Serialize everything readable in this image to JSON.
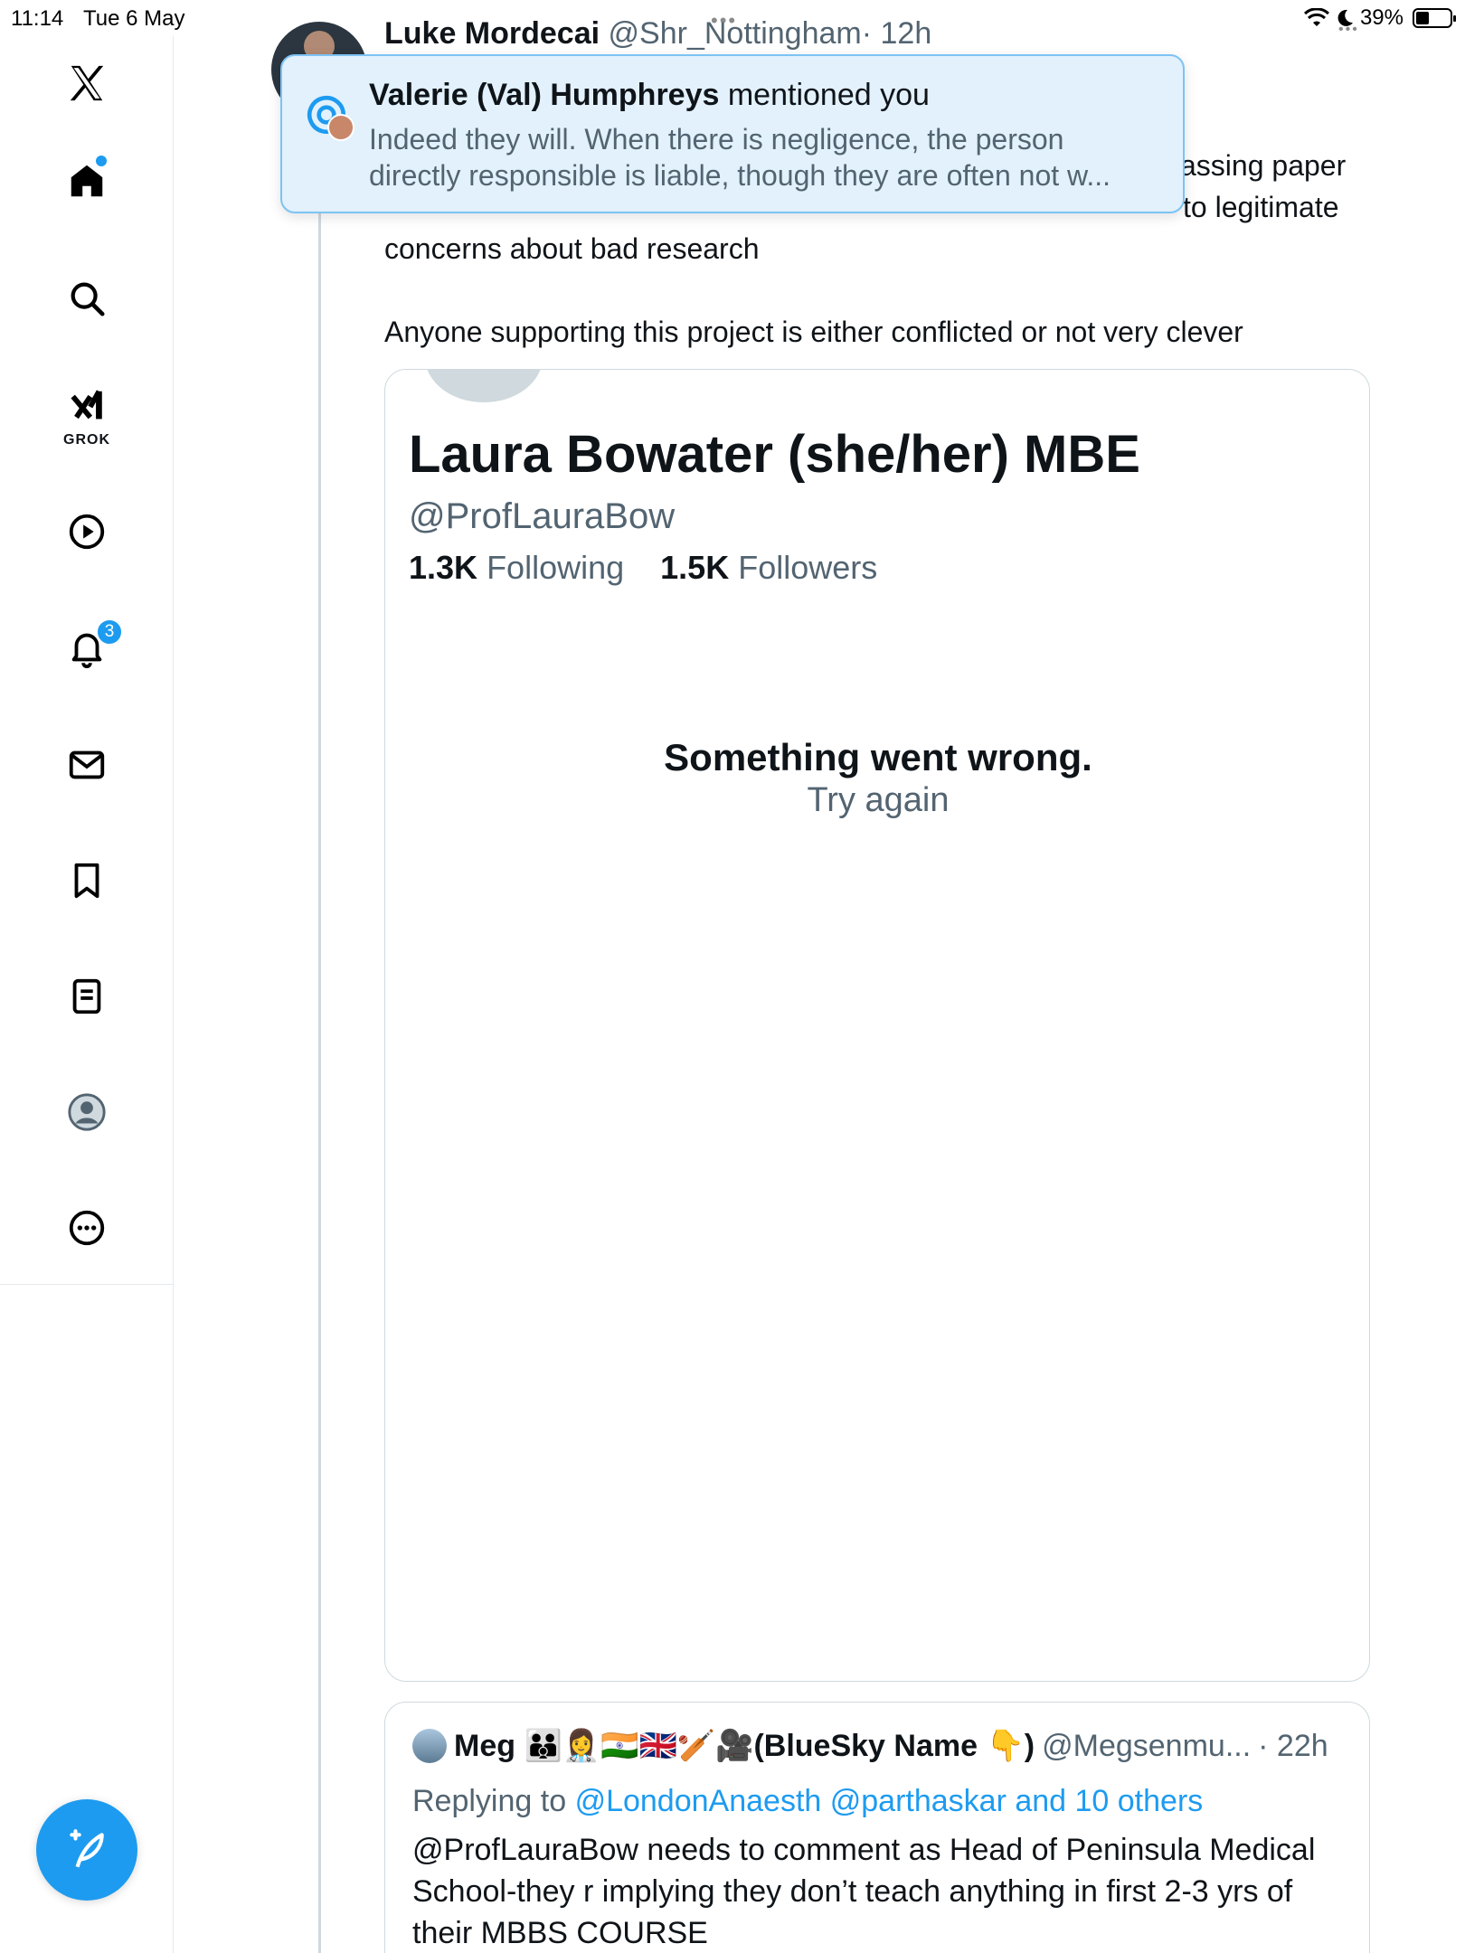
{
  "status_bar": {
    "time": "11:14",
    "date": "Tue 6 May",
    "battery": "39%",
    "battery_level": 0.39
  },
  "sidebar": {
    "items": [
      {
        "name": "x-logo-icon"
      },
      {
        "name": "home-icon"
      },
      {
        "name": "search-icon"
      },
      {
        "name": "grok-icon",
        "label": "GROK"
      },
      {
        "name": "video-icon"
      },
      {
        "name": "notifications-icon",
        "badge": "3"
      },
      {
        "name": "messages-icon"
      },
      {
        "name": "bookmarks-icon"
      },
      {
        "name": "lists-icon"
      },
      {
        "name": "profile-icon"
      },
      {
        "name": "more-icon"
      }
    ],
    "compose_icon": "compose-icon"
  },
  "tweet": {
    "author_name": "Luke Mordecai",
    "author_handle": "@Shr_Nottingham",
    "time": "· 12h",
    "text_line1_tail": "assing paper",
    "text_line2_tail": "to legitimate",
    "text_line3": "concerns about bad research",
    "text_line4": "Anyone supporting this project is either conflicted or not very clever"
  },
  "profile_card": {
    "name": "Laura Bowater (she/her) MBE",
    "handle": "@ProfLauraBow",
    "following_count": "1.3K",
    "following_label": "Following",
    "followers_count": "1.5K",
    "followers_label": "Followers",
    "error_title": "Something went wrong.",
    "retry_label": "Try again"
  },
  "reply": {
    "author_name": "Meg 👪👩‍⚕️🇮🇳🇬🇧🏏🎥(BlueSky Name 👇)",
    "author_handle": "@Megsenmu...",
    "time": "· 22h",
    "replying_to_label": "Replying to",
    "replying_to_links": "@LondonAnaesth @parthaskar and 10 others",
    "text": "@ProfLauraBow needs to comment as Head of Peninsula Medical School-they r implying they don’t teach anything in first 2-3 yrs of their MBBS COURSE"
  },
  "notification": {
    "sender": "Valerie (Val) Humphreys",
    "action": "mentioned you",
    "line1": "Indeed they will. When there is negligence, the person",
    "line2": "directly responsible is liable, though they are often not w..."
  },
  "colors": {
    "accent": "#1d9bf0",
    "toast_bg": "#e2f1fc",
    "muted_text": "#536471"
  }
}
